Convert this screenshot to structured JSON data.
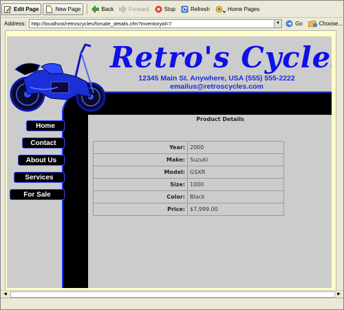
{
  "toolbar": {
    "edit_page": "Edit Page",
    "new_page": "New Page",
    "back": "Back",
    "forward": "Forward",
    "stop": "Stop",
    "refresh": "Refresh",
    "home_pages": "Home Pages"
  },
  "address": {
    "label": "Address:",
    "url": "http://localhost/retroscycles/forsale_details.cfm?inventoryid=7",
    "go": "Go",
    "choose": "Choose..."
  },
  "site": {
    "title": "Retro's Cycles",
    "address": "12345 Main St. Anywhere, USA (555) 555-2222",
    "email": "emailus@retroscycles.com",
    "accent_color": "#1a2dd6"
  },
  "nav": [
    {
      "label": "Home"
    },
    {
      "label": "Contact"
    },
    {
      "label": "About Us"
    },
    {
      "label": "Services"
    },
    {
      "label": "For Sale"
    }
  ],
  "details": {
    "title": "Product Details",
    "rows": [
      {
        "label": "Year:",
        "value": "2000"
      },
      {
        "label": "Make:",
        "value": "Suzuki"
      },
      {
        "label": "Model:",
        "value": "GSXR"
      },
      {
        "label": "Size:",
        "value": "1000"
      },
      {
        "label": "Color:",
        "value": "Black"
      },
      {
        "label": "Price:",
        "value": "$7,999.00"
      }
    ]
  }
}
